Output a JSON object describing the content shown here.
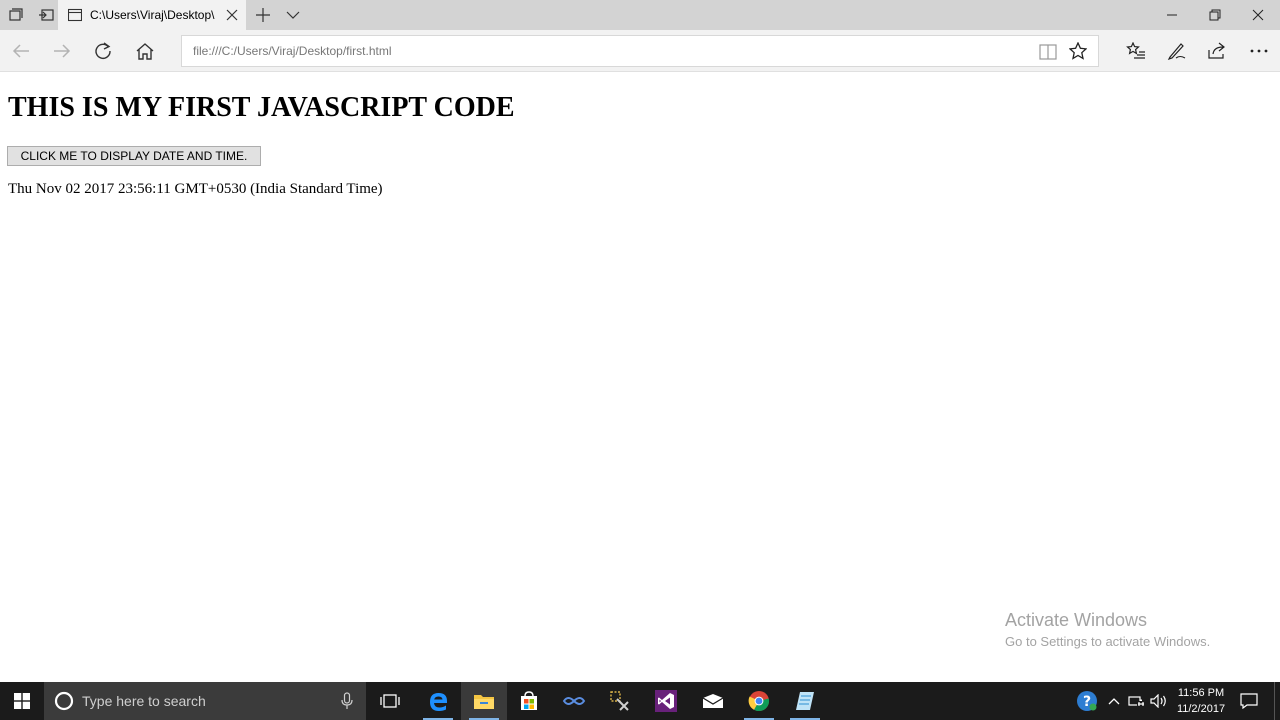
{
  "browser": {
    "tab_title": "C:\\Users\\Viraj\\Desktop\\",
    "address": "file:///C:/Users/Viraj/Desktop/first.html"
  },
  "page": {
    "heading": "THIS IS MY FIRST JAVASCRIPT CODE",
    "button_label": "CLICK ME TO DISPLAY DATE AND TIME.",
    "output_text": "Thu Nov 02 2017 23:56:11 GMT+0530 (India Standard Time)"
  },
  "watermark": {
    "title": "Activate Windows",
    "subtitle": "Go to Settings to activate Windows."
  },
  "taskbar": {
    "search_placeholder": "Type here to search",
    "time": "11:56 PM",
    "date": "11/2/2017",
    "apps": [
      "edge-icon",
      "file-explorer-icon",
      "store-icon",
      "app-icon",
      "tool-icon",
      "visual-studio-icon",
      "mail-icon",
      "chrome-icon",
      "notepad-icon"
    ]
  },
  "colors": {
    "tabbar_bg": "#d3d3d3",
    "toolbar_bg": "#f2f2f2",
    "taskbar_bg": "#1b1b1b",
    "edge_blue": "#0078d7",
    "vs_purple": "#68217a"
  }
}
